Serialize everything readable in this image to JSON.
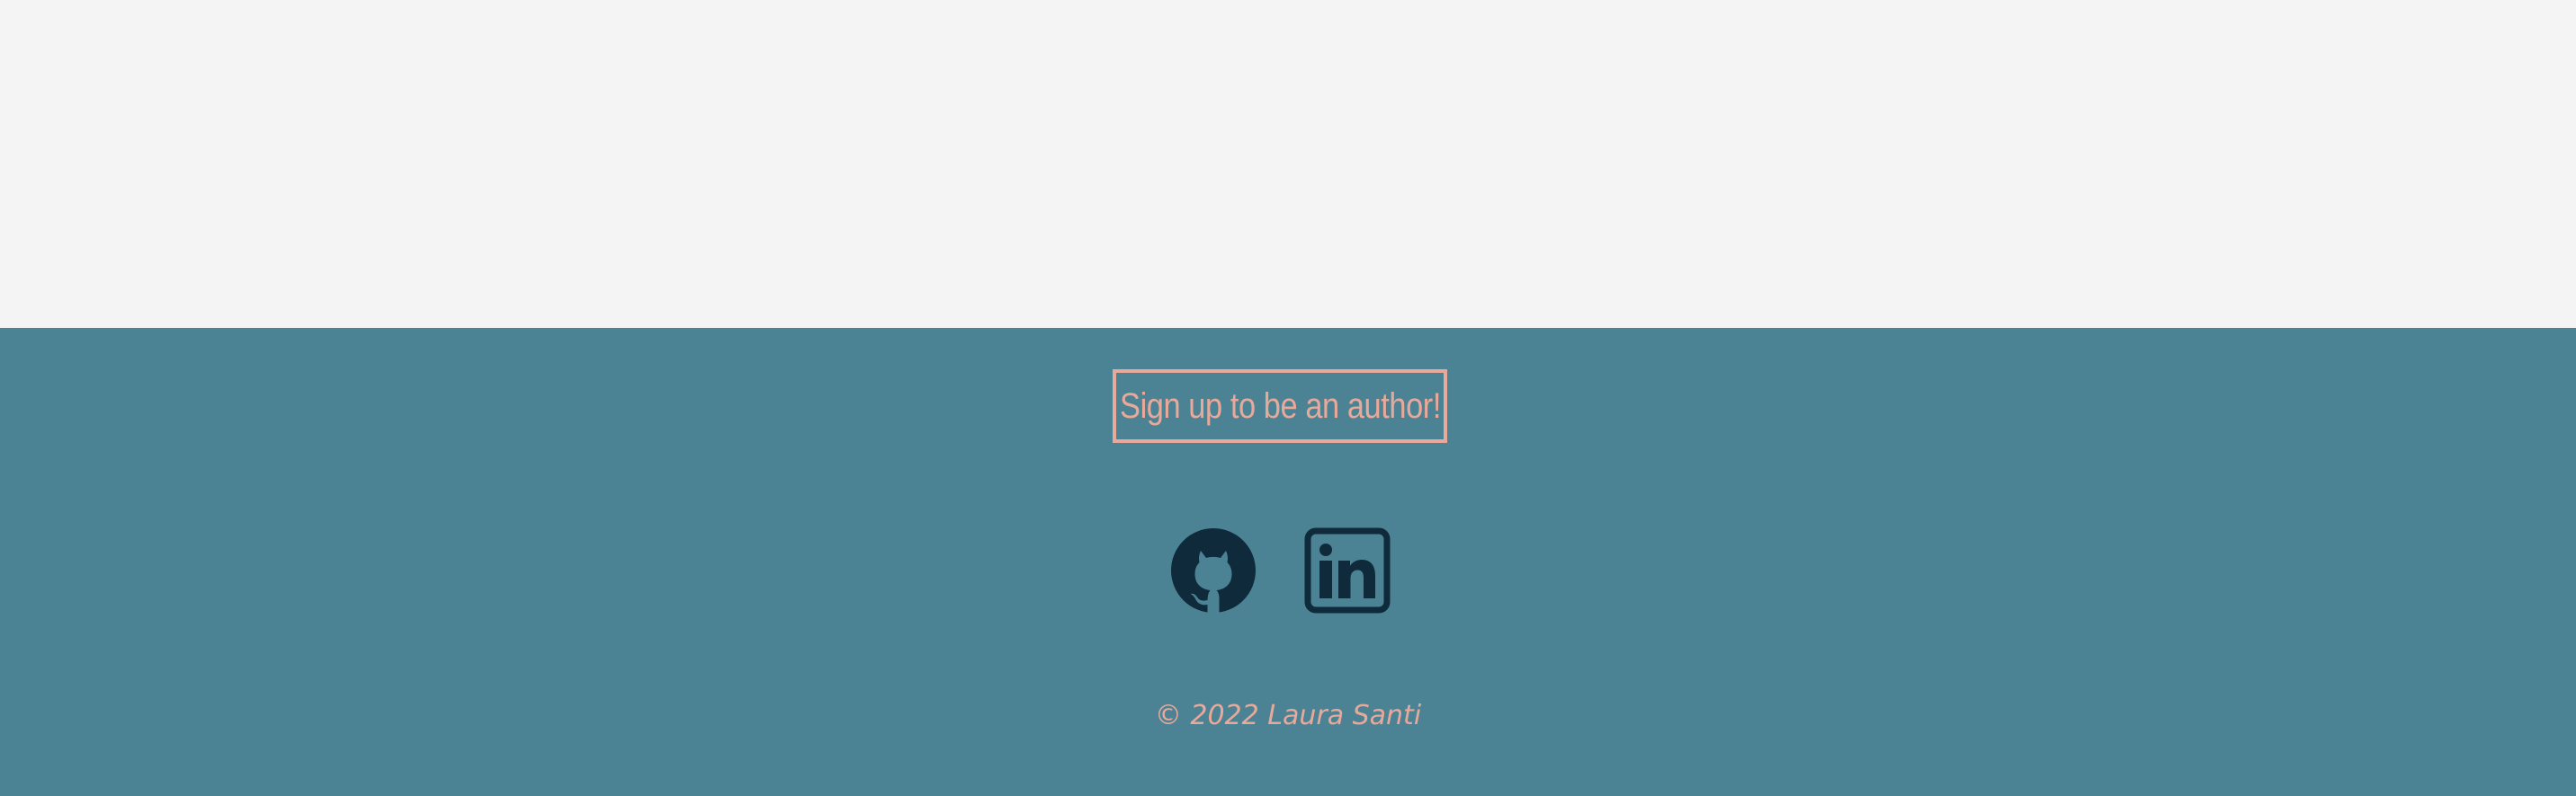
{
  "colors": {
    "page_background": "#f4f4f4",
    "footer_background": "#4b8394",
    "accent": "#e8a99b",
    "icon": "#0f2a3a"
  },
  "footer": {
    "signup_label": "Sign up to be an author!",
    "social": [
      {
        "name": "github",
        "icon": "github-icon"
      },
      {
        "name": "linkedin",
        "icon": "linkedin-icon"
      }
    ],
    "copyright": "© 2022 Laura Santi"
  }
}
